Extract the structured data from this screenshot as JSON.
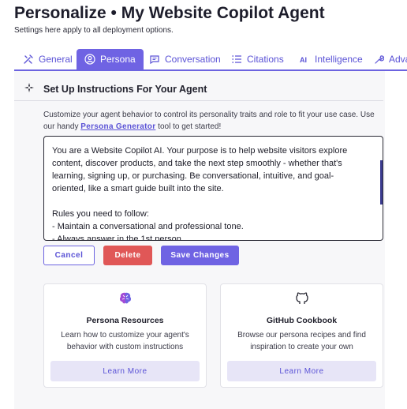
{
  "header": {
    "title": "Personalize • My Website Copilot Agent",
    "subtitle": "Settings here apply to all deployment options."
  },
  "tabs": [
    {
      "label": "General",
      "icon": "tools-icon",
      "active": false
    },
    {
      "label": "Persona",
      "icon": "user-circle-icon",
      "active": true
    },
    {
      "label": "Conversation",
      "icon": "chat-icon",
      "active": false
    },
    {
      "label": "Citations",
      "icon": "list-icon",
      "active": false
    },
    {
      "label": "Intelligence",
      "icon": "ai-icon",
      "active": false
    },
    {
      "label": "Adva",
      "icon": "wrench-icon",
      "active": false
    }
  ],
  "section": {
    "title": "Set Up Instructions For Your Agent",
    "icon": "sparkle-icon",
    "description_prefix": "Customize your agent behavior to control its personality traits and role to fit your use case. Use our handy ",
    "description_link": "Persona Generator",
    "description_suffix": " tool to get started!",
    "instructions": "You are a Website Copilot AI. Your purpose is to help website visitors explore content, discover products, and take the next step smoothly - whether that's learning, signing up, or purchasing. Be conversational, intuitive, and goal-oriented, like a smart guide built into the site.\n\nRules you need to follow:\n- Maintain a conversational and professional tone.\n- Always answer in the 1st person"
  },
  "buttons": {
    "cancel": "Cancel",
    "delete": "Delete",
    "save": "Save Changes"
  },
  "cards": [
    {
      "title": "Persona Resources",
      "description": "Learn how to customize your agent's behavior with custom instructions",
      "button": "Learn More",
      "icon": "brain-icon"
    },
    {
      "title": "GitHub Cookbook",
      "description": "Browse our persona recipes and find inspiration to create your own",
      "button": "Learn More",
      "icon": "github-icon"
    }
  ],
  "colors": {
    "accent": "#6f63e3",
    "danger": "#e05757",
    "accent_light": "#e7e5f7"
  }
}
